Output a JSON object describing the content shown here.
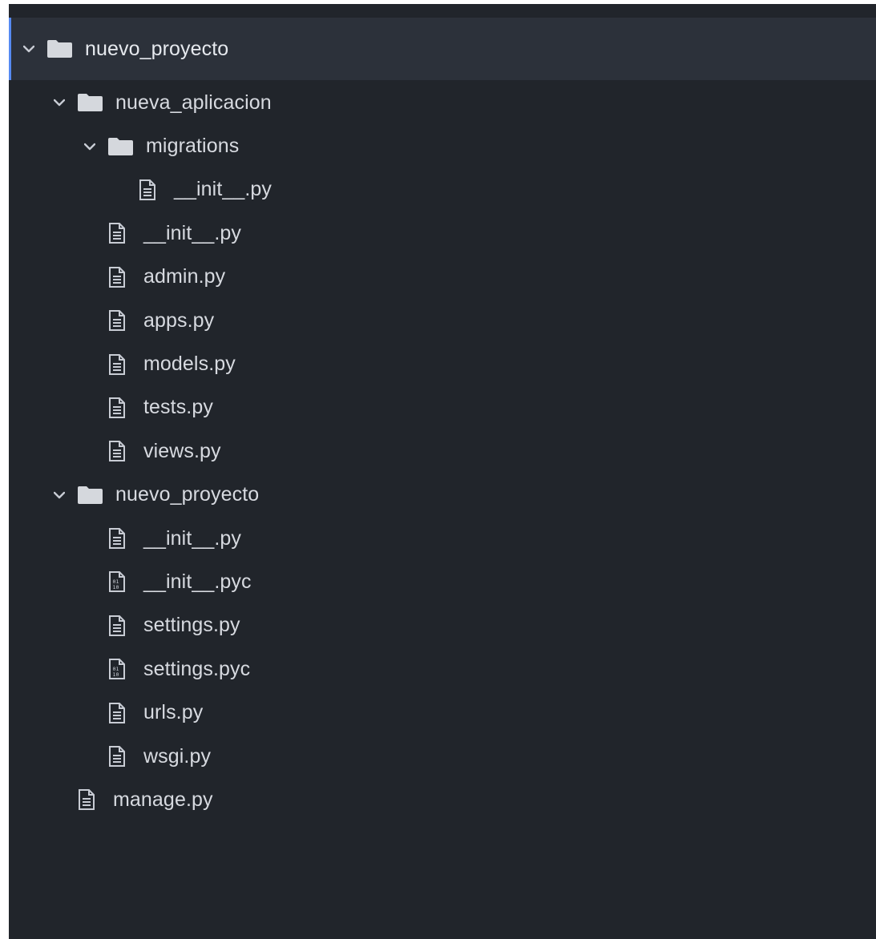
{
  "tree": {
    "root": {
      "label": "nuevo_proyecto",
      "expanded": true,
      "icon": "folder-icon"
    },
    "items": [
      {
        "label": "nueva_aplicacion",
        "type": "folder",
        "depth": 1,
        "expanded": true,
        "icon": "folder-icon"
      },
      {
        "label": "migrations",
        "type": "folder",
        "depth": 2,
        "expanded": true,
        "icon": "folder-icon"
      },
      {
        "label": "__init__.py",
        "type": "file",
        "depth": 3,
        "icon": "file-text-icon"
      },
      {
        "label": "__init__.py",
        "type": "file",
        "depth": 2,
        "icon": "file-text-icon"
      },
      {
        "label": "admin.py",
        "type": "file",
        "depth": 2,
        "icon": "file-text-icon"
      },
      {
        "label": "apps.py",
        "type": "file",
        "depth": 2,
        "icon": "file-text-icon"
      },
      {
        "label": "models.py",
        "type": "file",
        "depth": 2,
        "icon": "file-text-icon"
      },
      {
        "label": "tests.py",
        "type": "file",
        "depth": 2,
        "icon": "file-text-icon"
      },
      {
        "label": "views.py",
        "type": "file",
        "depth": 2,
        "icon": "file-text-icon"
      },
      {
        "label": "nuevo_proyecto",
        "type": "folder",
        "depth": 1,
        "expanded": true,
        "icon": "folder-icon"
      },
      {
        "label": "__init__.py",
        "type": "file",
        "depth": 2,
        "icon": "file-text-icon"
      },
      {
        "label": "__init__.pyc",
        "type": "file",
        "depth": 2,
        "icon": "file-binary-icon"
      },
      {
        "label": "settings.py",
        "type": "file",
        "depth": 2,
        "icon": "file-text-icon"
      },
      {
        "label": "settings.pyc",
        "type": "file",
        "depth": 2,
        "icon": "file-binary-icon"
      },
      {
        "label": "urls.py",
        "type": "file",
        "depth": 2,
        "icon": "file-text-icon"
      },
      {
        "label": "wsgi.py",
        "type": "file",
        "depth": 2,
        "icon": "file-text-icon"
      },
      {
        "label": "manage.py",
        "type": "file",
        "depth": 1,
        "icon": "file-text-icon"
      }
    ]
  },
  "colors": {
    "panel_background": "#21252b",
    "selected_row_background": "#2c313a",
    "selection_accent": "#568af2",
    "text": "#d7dae0",
    "icon": "#c8ccd4"
  }
}
